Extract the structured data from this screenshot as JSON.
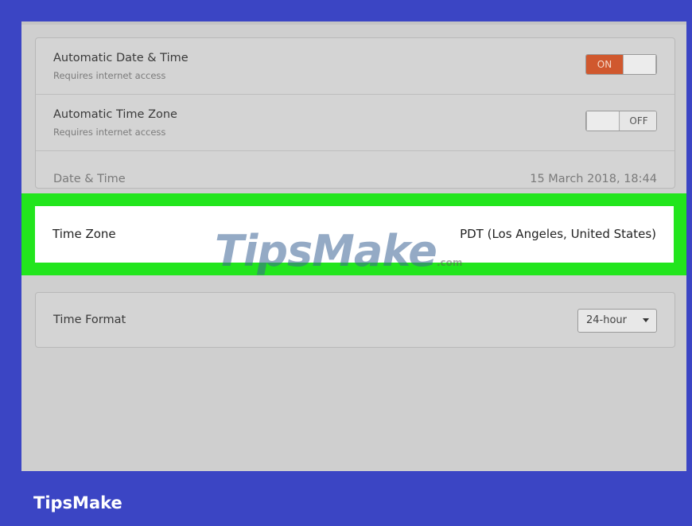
{
  "settings": {
    "auto_date_time": {
      "label": "Automatic Date & Time",
      "sublabel": "Requires internet access",
      "toggle_text": "ON",
      "state": "on"
    },
    "auto_time_zone": {
      "label": "Automatic Time Zone",
      "sublabel": "Requires internet access",
      "toggle_text": "OFF",
      "state": "off"
    },
    "date_time": {
      "label": "Date & Time",
      "value": "15 March 2018, 18:44"
    },
    "time_zone": {
      "label": "Time Zone",
      "value": "PDT (Los Angeles, United States)"
    },
    "time_format": {
      "label": "Time Format",
      "selected": "24-hour"
    }
  },
  "watermark": {
    "text": "TipsMake",
    "suffix": ".com"
  },
  "footer": {
    "brand": "TipsMake"
  },
  "colors": {
    "frame": "#3b45c4",
    "highlight": "#22e51d",
    "toggle_on": "#d0582e"
  }
}
